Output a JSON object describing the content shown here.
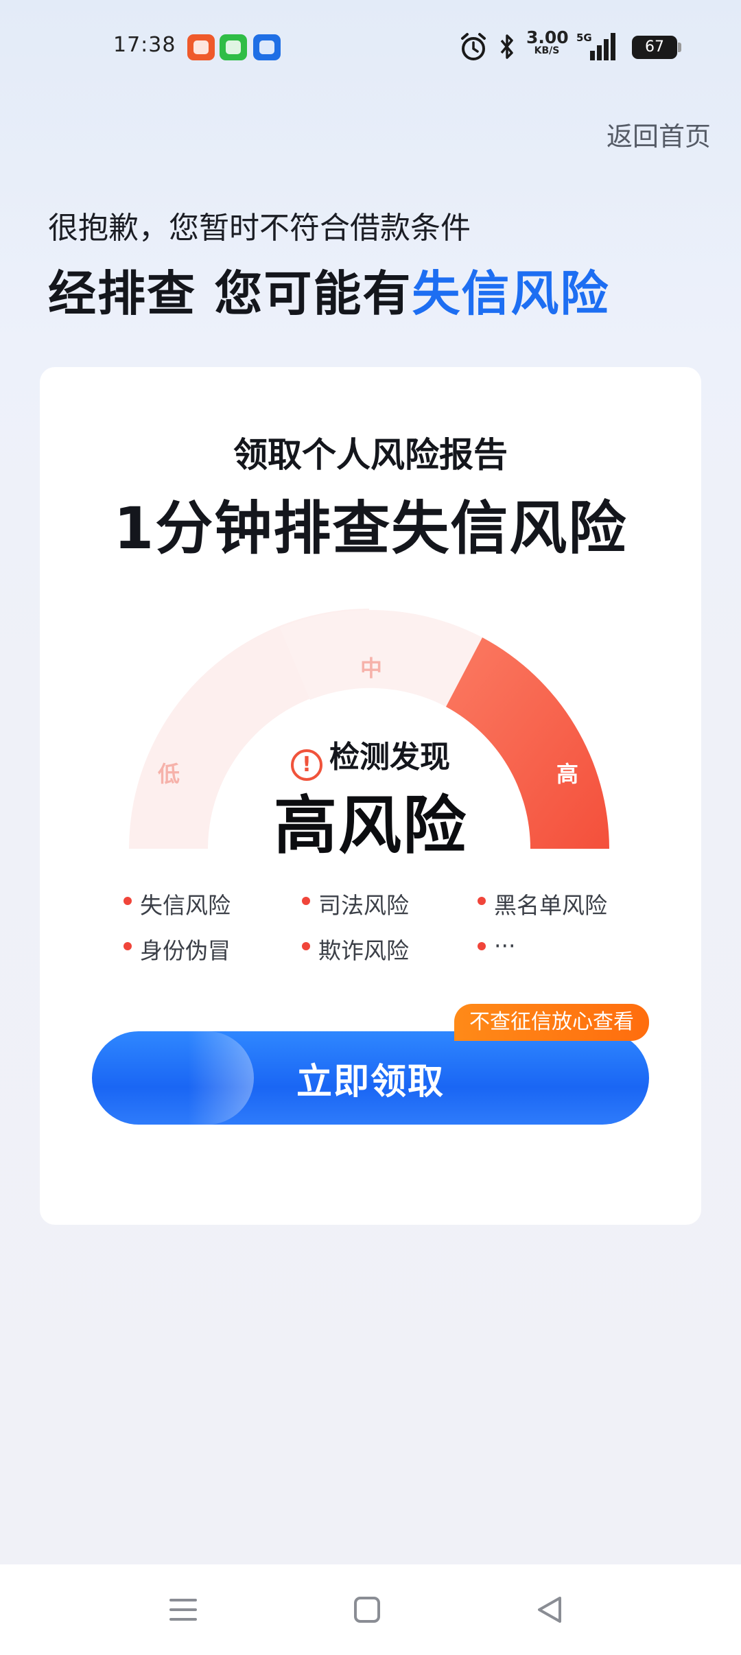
{
  "status_bar": {
    "time": "17:38",
    "net_speed": "3.00",
    "net_speed_unit": "KB/S",
    "network": "5G",
    "battery": "67",
    "icons": [
      "app-notification-icon",
      "message-app-icon",
      "bank-app-icon",
      "alarm-icon",
      "bluetooth-icon",
      "signal-icon"
    ]
  },
  "header": {
    "back_home": "返回首页",
    "subtitle": "很抱歉，您暂时不符合借款条件",
    "title_prefix": "经排查 您可能有",
    "title_highlight": "失信风险"
  },
  "card": {
    "subtitle": "领取个人风险报告",
    "title": "1分钟排查失信风险",
    "gauge": {
      "labels": [
        "低",
        "中",
        "高"
      ],
      "active": "高",
      "colors": {
        "inactive": "#fdeeed",
        "active": "#f7563f"
      }
    },
    "detect_label": "检测发现",
    "risk_level": "高风险",
    "tags": [
      "失信风险",
      "司法风险",
      "黑名单风险",
      "身份伪冒",
      "欺诈风险",
      "···"
    ],
    "cta": {
      "label": "立即领取",
      "badge": "不查征信放心查看"
    }
  },
  "colors": {
    "accent": "#1d6ef2",
    "danger": "#f0453a",
    "badge": "#ff7a12"
  },
  "nav_bar": {
    "buttons": [
      "menu-icon",
      "home-square-icon",
      "back-triangle-icon"
    ]
  }
}
